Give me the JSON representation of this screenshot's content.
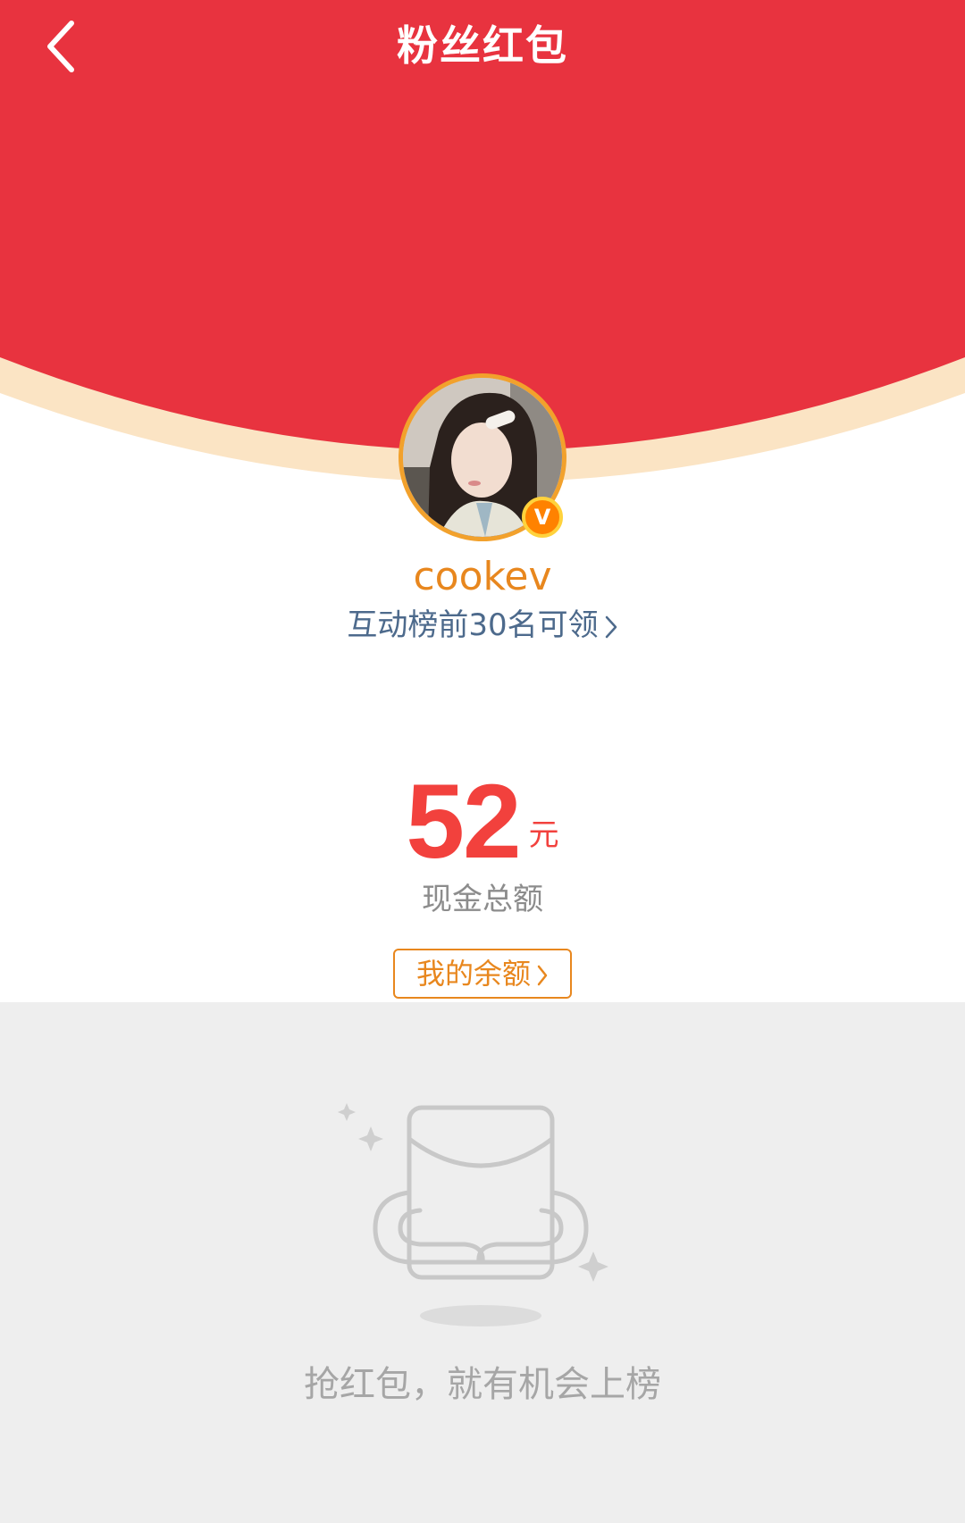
{
  "nav": {
    "title": "粉丝红包",
    "back_icon": "chevron-left-icon"
  },
  "colors": {
    "header_red": "#e8333f",
    "accent_orange": "#e8871e",
    "amount_red": "#f2413d",
    "link_blue": "#4d6a8c",
    "empty_bg": "#eeeeee"
  },
  "profile": {
    "username": "cookev",
    "verified_badge": "V",
    "rank_hint": "互动榜前30名可领"
  },
  "amount": {
    "value": "52",
    "unit": "元",
    "label": "现金总额"
  },
  "balance_button": {
    "label": "我的余额"
  },
  "empty_state": {
    "icon": "empty-red-envelope-icon",
    "message": "抢红包，就有机会上榜"
  }
}
